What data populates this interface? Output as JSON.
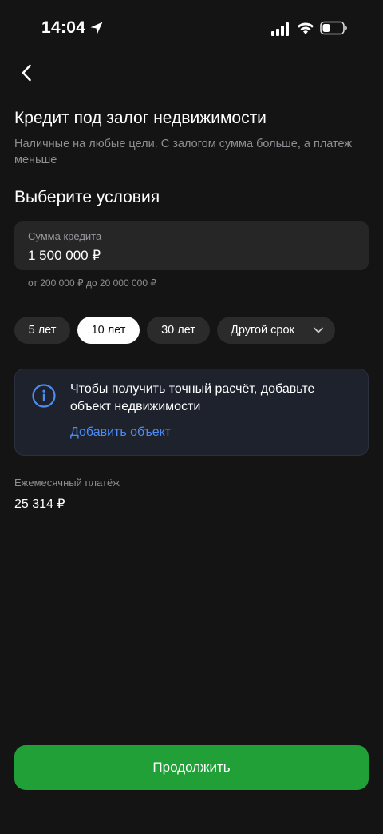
{
  "status_bar": {
    "time": "14:04"
  },
  "header": {
    "title": "Кредит под залог недвижимости",
    "subtitle": "Наличные на любые цели. С залогом сумма больше, а платеж меньше"
  },
  "conditions": {
    "section_title": "Выберите условия",
    "amount": {
      "label": "Сумма кредита",
      "value": "1 500 000 ₽",
      "hint": "от 200 000 ₽ до 20 000 000 ₽"
    },
    "terms": [
      {
        "label": "5 лет",
        "selected": false
      },
      {
        "label": "10 лет",
        "selected": true
      },
      {
        "label": "30 лет",
        "selected": false
      },
      {
        "label": "Другой срок",
        "selected": false
      }
    ]
  },
  "info_card": {
    "text": "Чтобы получить точный расчёт, добавьте объект недвижимости",
    "link": "Добавить объект"
  },
  "payment": {
    "label": "Ежемесячный платёж",
    "value": "25 314 ₽"
  },
  "footer": {
    "continue_label": "Продолжить"
  },
  "colors": {
    "background": "#141414",
    "accent_green": "#21a038",
    "link_blue": "#4d8cf5"
  }
}
